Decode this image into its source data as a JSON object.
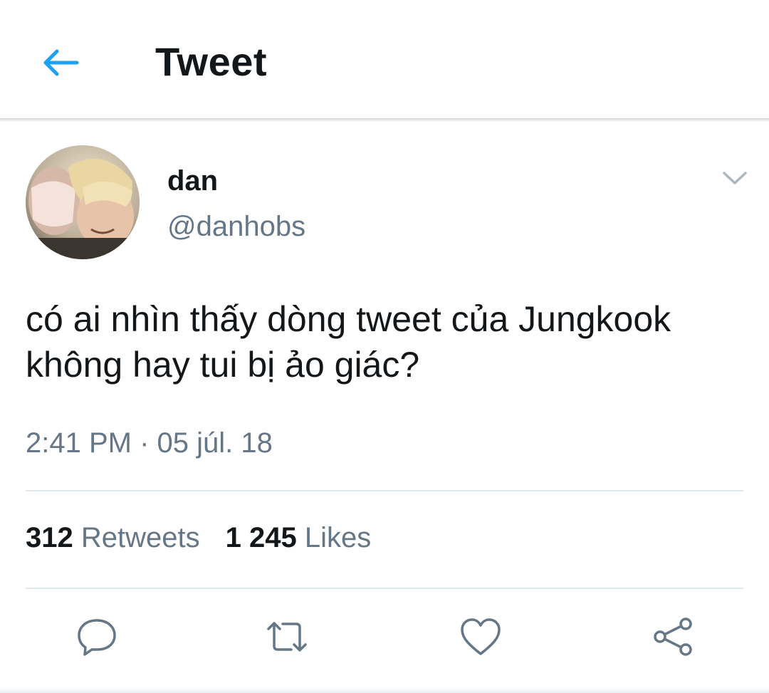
{
  "header": {
    "title": "Tweet",
    "back_icon": "arrow-left-icon",
    "accent_color": "#1da1f2"
  },
  "tweet": {
    "author": {
      "display_name": "dan",
      "handle": "@danhobs",
      "avatar": "profile-photo"
    },
    "menu_icon": "chevron-down-icon",
    "text_line1": "có ai nhìn thấy dòng tweet của Jungkook",
    "text_line2": "không hay tui bị ảo giác?",
    "timestamp": "2:41 PM · 05 júl. 18",
    "stats": {
      "retweets_count": "312",
      "retweets_label": "Retweets",
      "likes_count": "1 245",
      "likes_label": "Likes"
    },
    "actions": [
      "reply-icon",
      "retweet-icon",
      "like-icon",
      "share-icon"
    ]
  },
  "colors": {
    "text_primary": "#14171a",
    "text_secondary": "#657786",
    "divider": "#e1e8ed",
    "icon_gray": "#657786"
  }
}
